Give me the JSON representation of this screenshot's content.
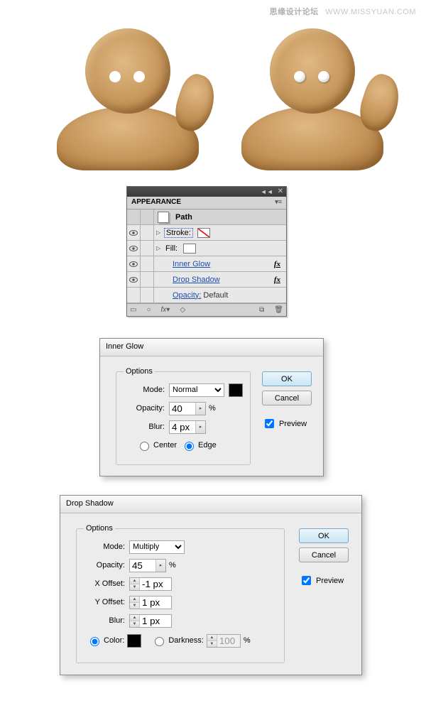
{
  "watermark": {
    "cn": "思缘设计论坛",
    "url": "WWW.MISSYUAN.COM"
  },
  "appearance": {
    "tab": "APPEARANCE",
    "title": "Path",
    "stroke_label": "Stroke:",
    "fill_label": "Fill:",
    "inner_glow": "Inner Glow",
    "drop_shadow": "Drop Shadow",
    "opacity_label": "Opacity:",
    "opacity_value": "Default",
    "fx": "fx"
  },
  "inner_glow": {
    "title": "Inner Glow",
    "options": "Options",
    "mode_label": "Mode:",
    "mode_value": "Normal",
    "opacity_label": "Opacity:",
    "opacity_value": "40",
    "opacity_unit": "%",
    "blur_label": "Blur:",
    "blur_value": "4 px",
    "center": "Center",
    "edge": "Edge",
    "ok": "OK",
    "cancel": "Cancel",
    "preview": "Preview",
    "color": "#000000"
  },
  "drop_shadow": {
    "title": "Drop Shadow",
    "options": "Options",
    "mode_label": "Mode:",
    "mode_value": "Multiply",
    "opacity_label": "Opacity:",
    "opacity_value": "45",
    "opacity_unit": "%",
    "xoff_label": "X Offset:",
    "xoff_value": "-1 px",
    "yoff_label": "Y Offset:",
    "yoff_value": "1 px",
    "blur_label": "Blur:",
    "blur_value": "1 px",
    "color_label": "Color:",
    "darkness_label": "Darkness:",
    "darkness_value": "100",
    "darkness_unit": "%",
    "ok": "OK",
    "cancel": "Cancel",
    "preview": "Preview",
    "color": "#000000"
  }
}
